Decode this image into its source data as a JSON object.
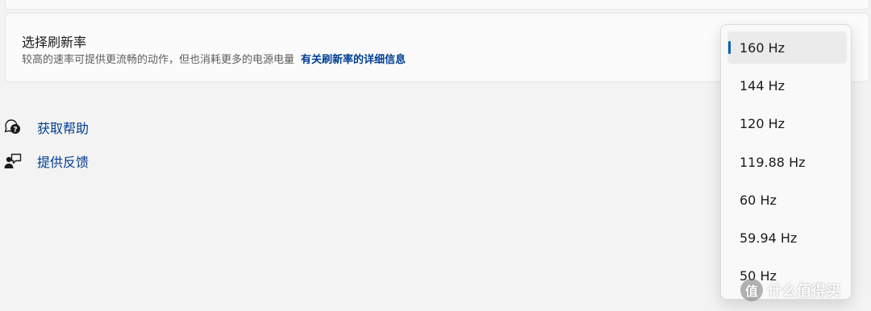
{
  "setting": {
    "title": "选择刷新率",
    "description": "较高的速率可提供更流畅的动作，但也消耗更多的电源电量",
    "link": "有关刷新率的详细信息"
  },
  "help_links": [
    {
      "label": "获取帮助",
      "icon": "help-chat-icon"
    },
    {
      "label": "提供反馈",
      "icon": "feedback-icon"
    }
  ],
  "refresh_dropdown": {
    "selected": "160 Hz",
    "options": [
      "160 Hz",
      "144 Hz",
      "120 Hz",
      "119.88 Hz",
      "60 Hz",
      "59.94 Hz",
      "50 Hz"
    ]
  },
  "watermark": {
    "badge": "值",
    "text": "什么值得买"
  },
  "colors": {
    "accent": "#005fb8",
    "link": "#003e92",
    "background": "#f3f3f3"
  }
}
